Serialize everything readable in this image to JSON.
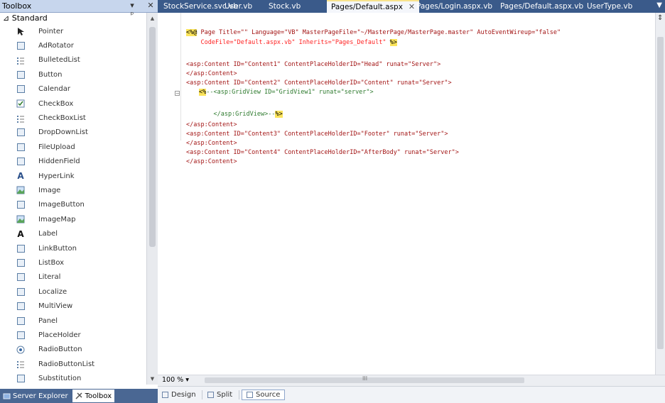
{
  "toolbox": {
    "title": "Toolbox",
    "pin_glyph": "▾ ᵖ",
    "close_glyph": "✕",
    "group": "⊿ Standard",
    "items": [
      {
        "label": "Pointer",
        "icon": "pointer-icon"
      },
      {
        "label": "AdRotator",
        "icon": "adrotator-icon"
      },
      {
        "label": "BulletedList",
        "icon": "bulleted-list-icon"
      },
      {
        "label": "Button",
        "icon": "button-icon"
      },
      {
        "label": "Calendar",
        "icon": "calendar-icon"
      },
      {
        "label": "CheckBox",
        "icon": "checkbox-icon"
      },
      {
        "label": "CheckBoxList",
        "icon": "checkbox-list-icon"
      },
      {
        "label": "DropDownList",
        "icon": "dropdown-list-icon"
      },
      {
        "label": "FileUpload",
        "icon": "file-upload-icon"
      },
      {
        "label": "HiddenField",
        "icon": "hidden-field-icon"
      },
      {
        "label": "HyperLink",
        "icon": "hyperlink-icon"
      },
      {
        "label": "Image",
        "icon": "image-icon"
      },
      {
        "label": "ImageButton",
        "icon": "image-button-icon"
      },
      {
        "label": "ImageMap",
        "icon": "image-map-icon"
      },
      {
        "label": "Label",
        "icon": "label-icon"
      },
      {
        "label": "LinkButton",
        "icon": "link-button-icon"
      },
      {
        "label": "ListBox",
        "icon": "listbox-icon"
      },
      {
        "label": "Literal",
        "icon": "literal-icon"
      },
      {
        "label": "Localize",
        "icon": "localize-icon"
      },
      {
        "label": "MultiView",
        "icon": "multiview-icon"
      },
      {
        "label": "Panel",
        "icon": "panel-icon"
      },
      {
        "label": "PlaceHolder",
        "icon": "placeholder-icon"
      },
      {
        "label": "RadioButton",
        "icon": "radio-button-icon"
      },
      {
        "label": "RadioButtonList",
        "icon": "radio-button-list-icon"
      },
      {
        "label": "Substitution",
        "icon": "substitution-icon"
      }
    ],
    "bottom_tabs": [
      {
        "label": "Server Explorer",
        "icon": "server-explorer-icon"
      },
      {
        "label": "Toolbox",
        "icon": "toolbox-icon"
      }
    ]
  },
  "tabs": [
    {
      "label": "StockService.svc.vb"
    },
    {
      "label": "User.vb"
    },
    {
      "label": "Stock.vb"
    },
    {
      "label": "Pages/Default.aspx"
    },
    {
      "label": "Pages/Login.aspx.vb"
    },
    {
      "label": "Pages/Default.aspx.vb"
    },
    {
      "label": "UserType.vb"
    }
  ],
  "active_tab_close": "✕",
  "code": {
    "l1_open": "<%@",
    "l1_text": " Page Title=\"\" Language=\"VB\" MasterPageFile=\"~/MasterPage/MasterPage.master\" AutoEventWireup=\"false\"",
    "l2_text": "    CodeFile=\"Default.aspx.vb\" Inherits=\"Pages_Default\" ",
    "l2_close": "%>",
    "l3": "<asp:Content ID=\"Content1\" ContentPlaceHolderID=\"Head\" runat=\"Server\">",
    "l4": "</asp:Content>",
    "l5": "<asp:Content ID=\"Content2\" ContentPlaceHolderID=\"Content\" runat=\"Server\">",
    "l6_open": "<%",
    "l6_text": "--<asp:GridView ID=\"GridView1\" runat=\"server\">",
    "l7_text": "    </asp:GridView>--",
    "l7_close": "%>",
    "l8": "</asp:Content>",
    "l9": "<asp:Content ID=\"Content3\" ContentPlaceHolderID=\"Footer\" runat=\"Server\">",
    "l10": "</asp:Content>",
    "l11": "<asp:Content ID=\"Content4\" ContentPlaceHolderID=\"AfterBody\" runat=\"Server\">",
    "l12": "</asp:Content>"
  },
  "statusbar": {
    "zoom": "100 %",
    "views": [
      {
        "label": "Design"
      },
      {
        "label": "Split"
      },
      {
        "label": "Source"
      }
    ]
  },
  "colors": {
    "tab_bar": "#3a5a8a",
    "toolbox_header": "#c7d6ed",
    "highlight": "#fbe45b"
  }
}
